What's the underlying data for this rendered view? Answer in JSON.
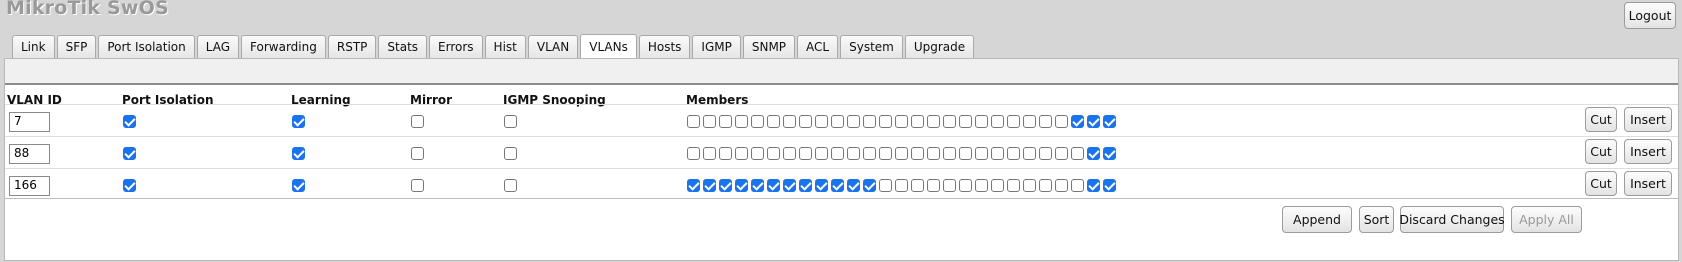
{
  "app": {
    "title": "MikroTik SwOS"
  },
  "header": {
    "logout_label": "Logout"
  },
  "tabs": [
    {
      "label": "Link",
      "active": false
    },
    {
      "label": "SFP",
      "active": false
    },
    {
      "label": "Port Isolation",
      "active": false
    },
    {
      "label": "LAG",
      "active": false
    },
    {
      "label": "Forwarding",
      "active": false
    },
    {
      "label": "RSTP",
      "active": false
    },
    {
      "label": "Stats",
      "active": false
    },
    {
      "label": "Errors",
      "active": false
    },
    {
      "label": "Hist",
      "active": false
    },
    {
      "label": "VLAN",
      "active": false
    },
    {
      "label": "VLANs",
      "active": true
    },
    {
      "label": "Hosts",
      "active": false
    },
    {
      "label": "IGMP",
      "active": false
    },
    {
      "label": "SNMP",
      "active": false
    },
    {
      "label": "ACL",
      "active": false
    },
    {
      "label": "System",
      "active": false
    },
    {
      "label": "Upgrade",
      "active": false
    }
  ],
  "table": {
    "headers": {
      "vlan_id": "VLAN ID",
      "port_isolation": "Port Isolation",
      "learning": "Learning",
      "mirror": "Mirror",
      "igmp_snooping": "IGMP Snooping",
      "members": "Members"
    },
    "rows": [
      {
        "vlan_id": "7",
        "port_isolation": true,
        "learning": true,
        "mirror": false,
        "igmp_snooping": false,
        "members": [
          false,
          false,
          false,
          false,
          false,
          false,
          false,
          false,
          false,
          false,
          false,
          false,
          false,
          false,
          false,
          false,
          false,
          false,
          false,
          false,
          false,
          false,
          false,
          false,
          true,
          true,
          true
        ]
      },
      {
        "vlan_id": "88",
        "port_isolation": true,
        "learning": true,
        "mirror": false,
        "igmp_snooping": false,
        "members": [
          false,
          false,
          false,
          false,
          false,
          false,
          false,
          false,
          false,
          false,
          false,
          false,
          false,
          false,
          false,
          false,
          false,
          false,
          false,
          false,
          false,
          false,
          false,
          false,
          false,
          true,
          true
        ]
      },
      {
        "vlan_id": "166",
        "port_isolation": true,
        "learning": true,
        "mirror": false,
        "igmp_snooping": false,
        "members": [
          true,
          true,
          true,
          true,
          true,
          true,
          true,
          true,
          true,
          true,
          true,
          true,
          false,
          false,
          false,
          false,
          false,
          false,
          false,
          false,
          false,
          false,
          false,
          false,
          false,
          true,
          true
        ]
      }
    ],
    "row_actions": {
      "cut_label": "Cut",
      "insert_label": "Insert"
    }
  },
  "footer": {
    "append_label": "Append",
    "sort_label": "Sort",
    "discard_label": "Discard Changes",
    "apply_label": "Apply All",
    "apply_disabled": true
  },
  "colors": {
    "checkbox_checked": "#1a73e8",
    "background": "#d6d6d6",
    "panel": "#ffffff"
  }
}
